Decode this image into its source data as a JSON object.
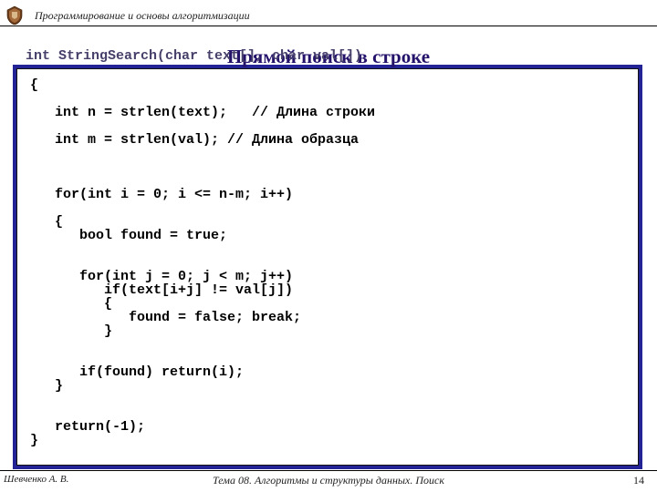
{
  "header": {
    "course_title": "Программирование и основы алгоритмизации"
  },
  "slide": {
    "title": "Прямой поиск в строке",
    "signature": "int StringSearch(char text[], char val[])"
  },
  "code": {
    "body": "{\n\n   int n = strlen(text);   // Длина строки\n\n   int m = strlen(val); // Длина образца\n\n\n\n   for(int i = 0; i <= n-m; i++)\n\n   {\n      bool found = true;\n\n\n      for(int j = 0; j < m; j++)\n         if(text[i+j] != val[j])\n         {\n            found = false; break;\n         }\n\n\n      if(found) return(i);\n   }\n\n\n   return(-1);\n}"
  },
  "footer": {
    "author": "Шевченко А. В.",
    "topic": "Тема 08. Алгоритмы и структуры данных. Поиск",
    "page_number": "14"
  }
}
